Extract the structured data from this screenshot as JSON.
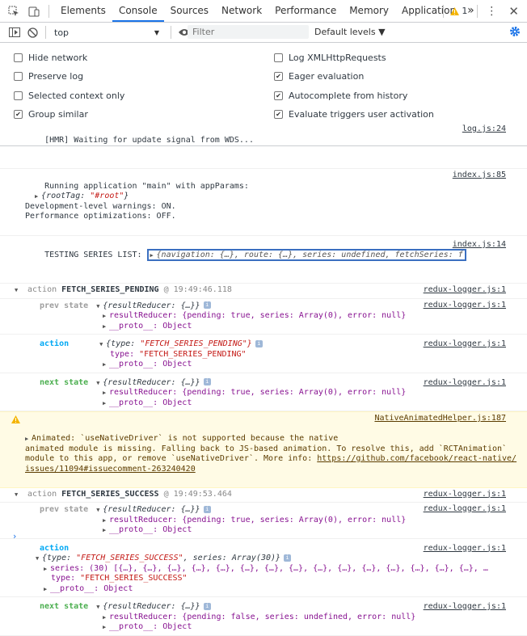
{
  "tabs": [
    "Elements",
    "Console",
    "Sources",
    "Network",
    "Performance",
    "Memory",
    "Application"
  ],
  "more_tabs": "»",
  "warnings_count": "1",
  "context": "top",
  "filter_placeholder": "Filter",
  "levels": "Default levels ▼",
  "settings": {
    "left": [
      {
        "label": "Hide network",
        "checked": false
      },
      {
        "label": "Preserve log",
        "checked": false
      },
      {
        "label": "Selected context only",
        "checked": false
      },
      {
        "label": "Group similar",
        "checked": true
      }
    ],
    "right": [
      {
        "label": "Log XMLHttpRequests",
        "checked": false
      },
      {
        "label": "Eager evaluation",
        "checked": true
      },
      {
        "label": "Autocomplete from history",
        "checked": true
      },
      {
        "label": "Evaluate triggers user activation",
        "checked": true
      }
    ]
  },
  "log": {
    "hmr": {
      "text": "[HMR] Waiting for update signal from WDS...",
      "src": "log.js:24"
    },
    "running": {
      "text": "Running application \"main\" with appParams:",
      "src": "index.js:85"
    },
    "roottag_key": "rootTag: ",
    "roottag_val": "\"#root\"",
    "devwarn": "Development-level warnings: ON.",
    "perfopt": "Performance optimizations: OFF.",
    "testing": {
      "text": "TESTING SERIES LIST: ",
      "obj": "{navigation: {…}, route: {…}, series: undefined, fetchSeries: f",
      "src": "index.js:14"
    },
    "g1": {
      "prefix": "action ",
      "name": "FETCH_SERIES_PENDING",
      "time": " @ 19:49:46.118",
      "src": "redux-logger.js:1"
    },
    "g1_prev": {
      "label": "prev state",
      "obj": "{resultReducer: {…}}",
      "src": "redux-logger.js:1",
      "child": "resultReducer: {pending: true, series: Array(0), error: null}",
      "proto": "__proto__: Object"
    },
    "g1_action": {
      "label": "action",
      "obj_key": "{type: ",
      "obj_val": "\"FETCH_SERIES_PENDING\"}",
      "src": "redux-logger.js:1",
      "child_key": "type: ",
      "child_val": "\"FETCH_SERIES_PENDING\"",
      "proto": "__proto__: Object"
    },
    "g1_next": {
      "label": "next state",
      "obj": "{resultReducer: {…}}",
      "src": "redux-logger.js:1",
      "child": "resultReducer: {pending: true, series: Array(0), error: null}",
      "proto": "__proto__: Object"
    },
    "warn": {
      "l1": "Animated: `useNativeDriver` is not supported because the native",
      "src": "NativeAnimatedHelper.js:187",
      "l2": "animated module is missing. Falling back to JS-based animation. To resolve this, add `RCTAnimation`",
      "l3": "module to this app, or remove `useNativeDriver`. More info: ",
      "link1": "https://github.com/facebook/react-native/",
      "link2": "issues/11094#issuecomment-263240420"
    },
    "g2": {
      "prefix": "action ",
      "name": "FETCH_SERIES_SUCCESS",
      "time": " @ 19:49:53.464",
      "src": "redux-logger.js:1"
    },
    "g2_prev": {
      "label": "prev state",
      "obj": "{resultReducer: {…}}",
      "src": "redux-logger.js:1",
      "child": "resultReducer: {pending: true, series: Array(0), error: null}",
      "proto": "__proto__: Object"
    },
    "g2_action": {
      "label": "action",
      "src": "redux-logger.js:1",
      "obj_key": "{type: ",
      "obj_val": "\"FETCH_SERIES_SUCCESS\"",
      "obj_rest": ", series: Array(30)}",
      "series": "series: (30) [{…}, {…}, {…}, {…}, {…}, {…}, {…}, {…}, {…}, {…}, {…}, {…}, {…}, {…}, {…}, …",
      "type_key": "type: ",
      "type_val": "\"FETCH_SERIES_SUCCESS\"",
      "proto": "__proto__: Object"
    },
    "g2_next": {
      "label": "next state",
      "obj": "{resultReducer: {…}}",
      "src": "redux-logger.js:1",
      "child": "resultReducer: {pending: false, series: undefined, error: null}",
      "proto": "__proto__: Object"
    }
  },
  "prompt": "›"
}
